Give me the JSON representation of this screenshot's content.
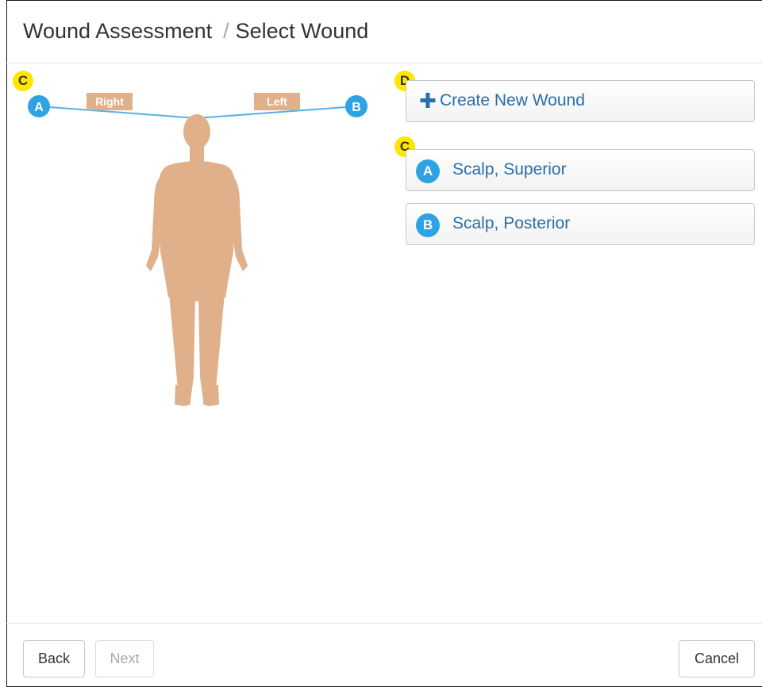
{
  "header": {
    "breadcrumb_root": "Wound Assessment",
    "breadcrumb_separator": "/",
    "breadcrumb_current": "Select Wound"
  },
  "annotations": {
    "body_map_marker": "C",
    "create_marker": "D",
    "wound_list_marker": "C"
  },
  "body_map": {
    "side_right_label": "Right",
    "side_left_label": "Left",
    "pin_a": "A",
    "pin_b": "B",
    "skin_color": "#e0b08a",
    "pin_color": "#2ea3e3",
    "line_color": "#55b0e6"
  },
  "actions": {
    "create_label": "Create New Wound",
    "create_icon": "plus-icon"
  },
  "wounds": [
    {
      "badge": "A",
      "label": "Scalp, Superior"
    },
    {
      "badge": "B",
      "label": "Scalp, Posterior"
    }
  ],
  "footer": {
    "back_label": "Back",
    "next_label": "Next",
    "cancel_label": "Cancel"
  },
  "colors": {
    "link": "#2a6fa8",
    "badge": "#2ea3e3",
    "marker": "#ffe600"
  }
}
